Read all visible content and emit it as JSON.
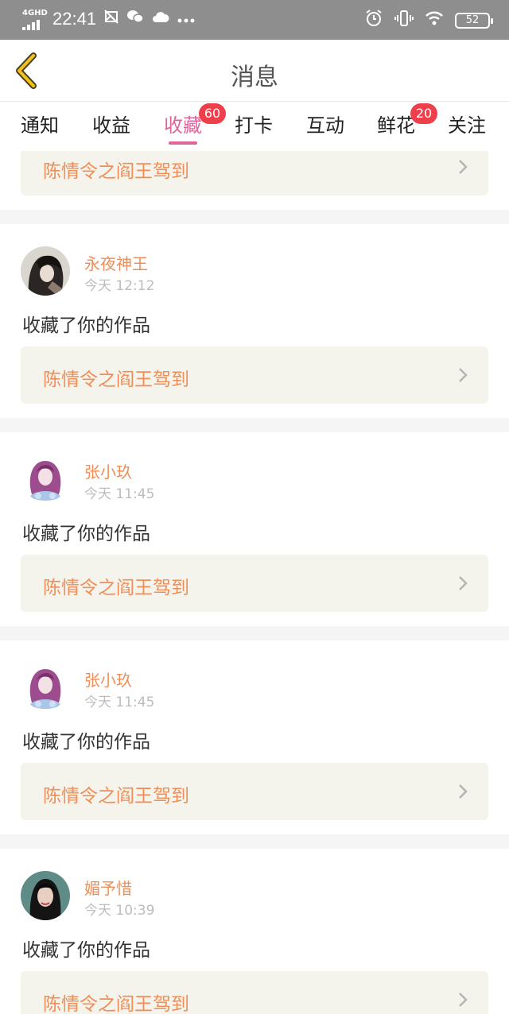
{
  "status_bar": {
    "network": "4GHD",
    "time": "22:41",
    "battery": "52",
    "left_icons": [
      "image-icon",
      "wechat-icon",
      "cloud-icon",
      "more-dots-icon"
    ],
    "right_icons": [
      "alarm-icon",
      "vibrate-icon",
      "wifi-icon",
      "battery-icon"
    ]
  },
  "header": {
    "title": "消息",
    "back_icon": "back-chevron-icon"
  },
  "tabs": [
    {
      "label": "通知",
      "active": false
    },
    {
      "label": "收益",
      "active": false
    },
    {
      "label": "收藏",
      "active": true,
      "badge": "60"
    },
    {
      "label": "打卡",
      "active": false
    },
    {
      "label": "互动",
      "active": false
    },
    {
      "label": "鲜花",
      "active": false,
      "badge": "20"
    },
    {
      "label": "关注",
      "active": false
    }
  ],
  "colors": {
    "accent": "#e0659c",
    "name": "#ef8e58",
    "badge": "#ef3f4a",
    "work_bg": "#f4f4ec"
  },
  "feed": [
    {
      "username": "",
      "time": "",
      "action": "",
      "work_title": "陈情令之阎王驾到"
    },
    {
      "username": "永夜神王",
      "time": "今天 12:12",
      "action": "收藏了你的作品",
      "work_title": "陈情令之阎王驾到",
      "avatar": "dark-hair-avatar"
    },
    {
      "username": "张小玖",
      "time": "今天 11:45",
      "action": "收藏了你的作品",
      "work_title": "陈情令之阎王驾到",
      "avatar": "purple-anime-avatar"
    },
    {
      "username": "张小玖",
      "time": "今天 11:45",
      "action": "收藏了你的作品",
      "work_title": "陈情令之阎王驾到",
      "avatar": "purple-anime-avatar"
    },
    {
      "username": "媚予惜",
      "time": "今天 10:39",
      "action": "收藏了你的作品",
      "work_title": "陈情令之阎王驾到",
      "avatar": "teal-portrait-avatar"
    }
  ]
}
